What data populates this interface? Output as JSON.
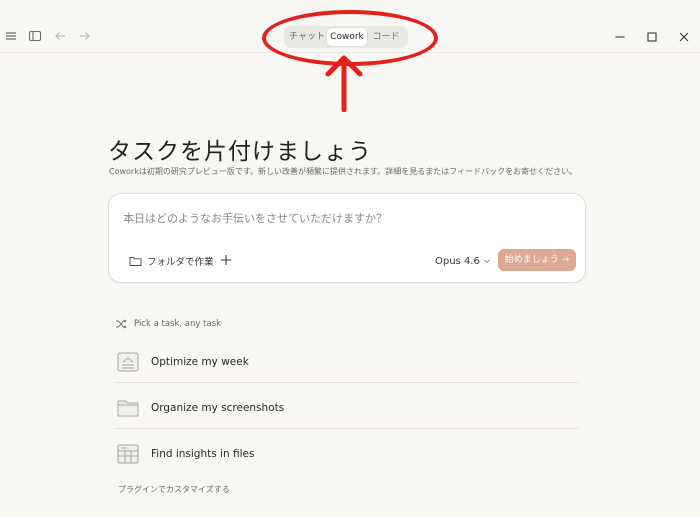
{
  "window": {
    "tabs": [
      {
        "label": "チャット",
        "active": false
      },
      {
        "label": "Cowork",
        "active": true
      },
      {
        "label": "コード",
        "active": false
      }
    ],
    "icons": [
      "menu-icon",
      "sidebar-toggle-icon",
      "back-arrow-icon",
      "forward-arrow-icon",
      "minimize-icon",
      "maximize-icon",
      "close-icon"
    ]
  },
  "main": {
    "title": "タスクを片付けましょう",
    "subtitle": "Coworkは初期の研究プレビュー版です。新しい改善が頻繁に提供されます。詳細を見るまたはフィードバックをお寄せください。"
  },
  "composer": {
    "placeholder": "本日はどのようなお手伝いをさせていただけますか？",
    "folder_label": "フォルダで作業",
    "model": "Opus 4.6",
    "start_label": "始めましょう →"
  },
  "tasks": {
    "header": "Pick a task, any task",
    "items": [
      {
        "label": "Optimize my week",
        "icon": "calendar-icon"
      },
      {
        "label": "Organize my screenshots",
        "icon": "folder-icon"
      },
      {
        "label": "Find insights in files",
        "icon": "spreadsheet-icon"
      }
    ],
    "footer": "プラグインでカスタマイズする"
  },
  "colors": {
    "background": "#f8f7f3",
    "accent_button": "#dda995",
    "annotation": "#e4201c"
  }
}
